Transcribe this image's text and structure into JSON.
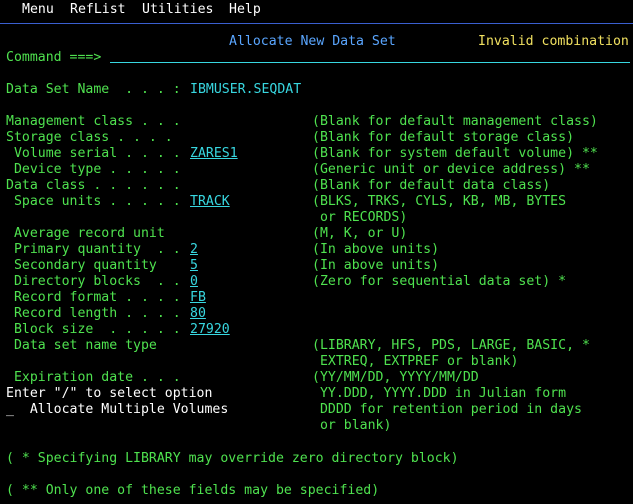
{
  "menu": [
    "Menu",
    "RefList",
    "Utilities",
    "Help"
  ],
  "panel_title": "Allocate New Data Set",
  "message": "Invalid combination",
  "command_label": "Command ===>",
  "dsname": {
    "label": "Data Set Name  . . . :",
    "value": "IBMUSER.SEQDAT"
  },
  "rows": [
    {
      "label": "Management class . . .",
      "value": "",
      "hint": "(Blank for default management class)"
    },
    {
      "label": "Storage class . . . .",
      "value": "",
      "hint": "(Blank for default storage class)"
    },
    {
      "label": " Volume serial . . . .",
      "value": "ZARES1",
      "hint": "(Blank for system default volume) **"
    },
    {
      "label": " Device type . . . . .",
      "value": "",
      "hint": "(Generic unit or device address) **"
    },
    {
      "label": "Data class . . . . . .",
      "value": "",
      "hint": "(Blank for default data class)"
    },
    {
      "label": " Space units . . . . .",
      "value": "TRACK",
      "hint": "(BLKS, TRKS, CYLS, KB, MB, BYTES"
    },
    {
      "label": "",
      "value": null,
      "hint": " or RECORDS)"
    },
    {
      "label": " Average record unit",
      "value": "",
      "hint": "(M, K, or U)"
    },
    {
      "label": " Primary quantity  . .",
      "value": "2",
      "hint": "(In above units)"
    },
    {
      "label": " Secondary quantity",
      "value": "5",
      "hint": "(In above units)"
    },
    {
      "label": " Directory blocks  . .",
      "value": "0",
      "hint": "(Zero for sequential data set) *"
    },
    {
      "label": " Record format . . . .",
      "value": "FB",
      "hint": ""
    },
    {
      "label": " Record length . . . .",
      "value": "80",
      "hint": ""
    },
    {
      "label": " Block size  . . . . .",
      "value": "27920",
      "hint": ""
    },
    {
      "label": " Data set name type",
      "value": "",
      "hint": "(LIBRARY, HFS, PDS, LARGE, BASIC, *"
    },
    {
      "label": "",
      "value": null,
      "hint": " EXTREQ, EXTPREF or blank)"
    },
    {
      "label": " Expiration date . . .",
      "value": "",
      "hint": "(YY/MM/DD, YYYY/MM/DD"
    },
    {
      "label": "Enter \"/\" to select option",
      "value": null,
      "hint": " YY.DDD, YYYY.DDD in Julian form"
    },
    {
      "label": "_  Allocate Multiple Volumes",
      "value": null,
      "hint": " DDDD for retention period in days"
    },
    {
      "label": "",
      "value": null,
      "hint": " or blank)"
    }
  ],
  "notes": [
    "( * Specifying LIBRARY may override zero directory block)",
    "( ** Only one of these fields may be specified)"
  ]
}
